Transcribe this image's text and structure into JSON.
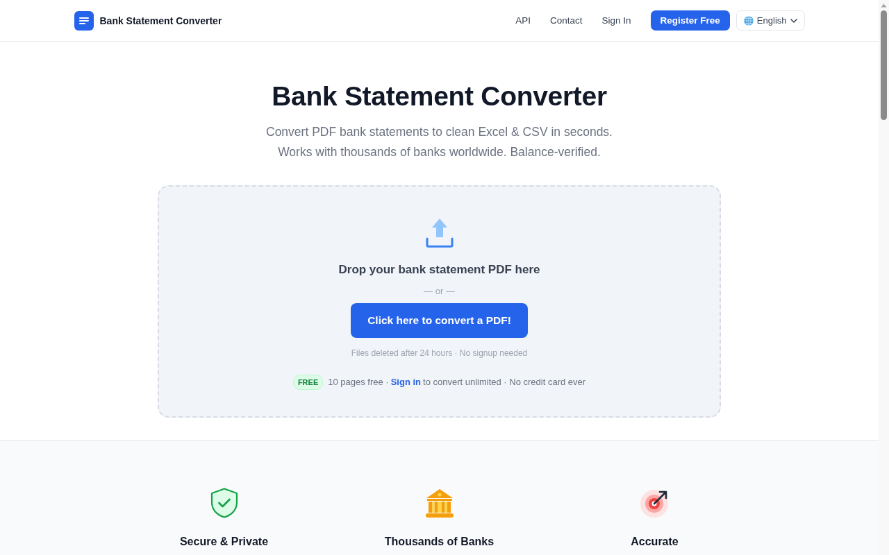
{
  "header": {
    "brand": "Bank Statement Converter",
    "nav": [
      {
        "label": "API",
        "kind": "link"
      },
      {
        "label": "Contact",
        "kind": "link"
      },
      {
        "label": "Sign In",
        "kind": "link"
      },
      {
        "label": "Register Free",
        "kind": "button"
      }
    ],
    "language": {
      "value": "English"
    }
  },
  "hero": {
    "title": "Bank Statement Converter",
    "subtitle_lines": [
      "Convert PDF bank statements to clean Excel & CSV in seconds.",
      "Works with thousands of banks worldwide. Balance-verified."
    ]
  },
  "dropzone": {
    "heading": "Drop your bank statement PDF here",
    "separator": "— or —",
    "button": "Click here to convert a PDF!",
    "note": "Files deleted after 24 hours · No signup needed",
    "offer": {
      "badge": "FREE",
      "before": "10 pages free ·",
      "link": "Sign in",
      "after": "to convert unlimited · No credit card ever"
    }
  },
  "features": [
    {
      "kind": "shield",
      "title": "Secure & Private"
    },
    {
      "kind": "bank",
      "title": "Thousands of Banks"
    },
    {
      "kind": "target",
      "title": "Accurate"
    }
  ]
}
